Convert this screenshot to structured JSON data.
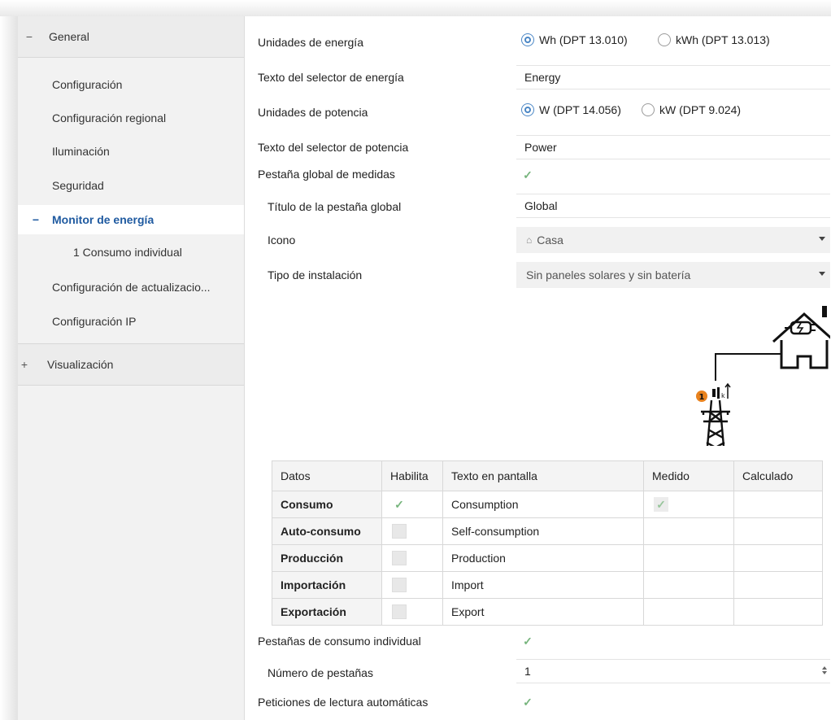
{
  "sidebar": {
    "general": {
      "sign": "−",
      "label": "General"
    },
    "items": [
      {
        "label": "Configuración"
      },
      {
        "label": "Configuración regional"
      },
      {
        "label": "Iluminación"
      },
      {
        "label": "Seguridad"
      }
    ],
    "active": {
      "sign": "−",
      "label": "Monitor de energía"
    },
    "sub": {
      "label": "1 Consumo individual"
    },
    "items2": [
      {
        "label": "Configuración de actualizacio..."
      },
      {
        "label": "Configuración IP"
      }
    ],
    "visual": {
      "sign": "+",
      "label": "Visualización"
    }
  },
  "settings": {
    "energy_units": {
      "label": "Unidades de energía",
      "opt1": "Wh (DPT 13.010)",
      "opt2": "kWh (DPT 13.013)",
      "selected": 1
    },
    "energy_text": {
      "label": "Texto del selector de energía",
      "value": "Energy"
    },
    "power_units": {
      "label": "Unidades de potencia",
      "opt1": "W (DPT 14.056)",
      "opt2": "kW (DPT 9.024)",
      "selected": 1
    },
    "power_text": {
      "label": "Texto del selector de potencia",
      "value": "Power"
    },
    "global_tab": {
      "label": "Pestaña global de medidas",
      "checked": true
    },
    "global_title": {
      "label": "Título de la pestaña global",
      "value": "Global"
    },
    "icon": {
      "label": "Icono",
      "value": "Casa"
    },
    "install_type": {
      "label": "Tipo de instalación",
      "value": "Sin paneles solares y sin batería"
    },
    "individual_tabs": {
      "label": "Pestañas de consumo individual",
      "checked": true
    },
    "tab_count": {
      "label": "Número de pestañas",
      "value": "1"
    },
    "auto_read": {
      "label": "Peticiones de lectura automáticas",
      "checked": true
    }
  },
  "diagram": {
    "badge": "1",
    "house_icon": "house-plug-icon",
    "tower_icon": "power-tower-icon"
  },
  "table": {
    "headers": [
      "Datos",
      "Habilita",
      "Texto en pantalla",
      "Medido",
      "Calculado"
    ],
    "rows": [
      {
        "name": "Consumo",
        "enabled": true,
        "text": "Consumption",
        "measured": true
      },
      {
        "name": "Auto-consumo",
        "enabled": false,
        "text": "Self-consumption",
        "measured": false
      },
      {
        "name": "Producción",
        "enabled": false,
        "text": "Production",
        "measured": false
      },
      {
        "name": "Importación",
        "enabled": false,
        "text": "Import",
        "measured": false
      },
      {
        "name": "Exportación",
        "enabled": false,
        "text": "Export",
        "measured": false
      }
    ]
  },
  "colors": {
    "accent": "#1f5aa0",
    "check": "#77b57d",
    "badge": "#e8821e",
    "radio": "#4a86c5"
  }
}
